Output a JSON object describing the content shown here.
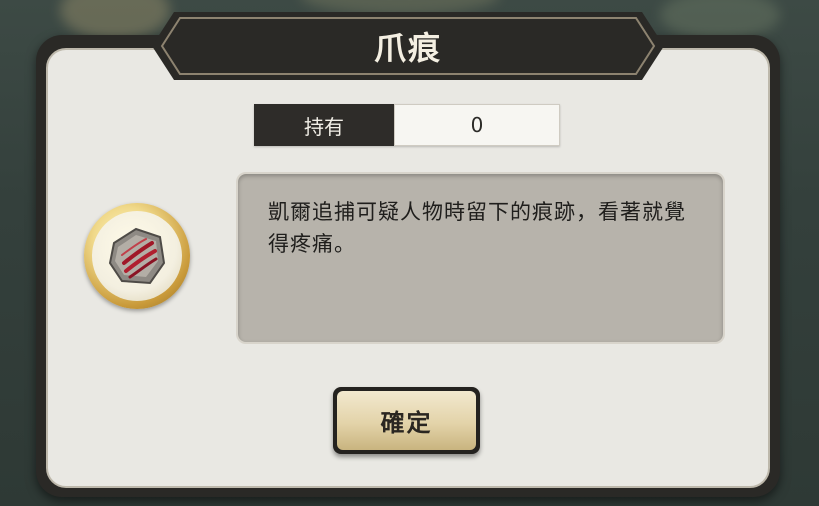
{
  "dialog": {
    "title": "爪痕"
  },
  "owned": {
    "label": "持有",
    "value": "0"
  },
  "item": {
    "icon": "claw-mark-stone-icon",
    "description": "凱爾追捕可疑人物時留下的痕跡，看著就覺得疼痛。"
  },
  "confirm": {
    "label": "確定"
  },
  "colors": {
    "frame": "#2a2926",
    "panel": "#e9e8e3",
    "desc_bg": "#b7b3ab",
    "button_gold": "#e3d3a9",
    "icon_gold": "#c99a3a"
  }
}
